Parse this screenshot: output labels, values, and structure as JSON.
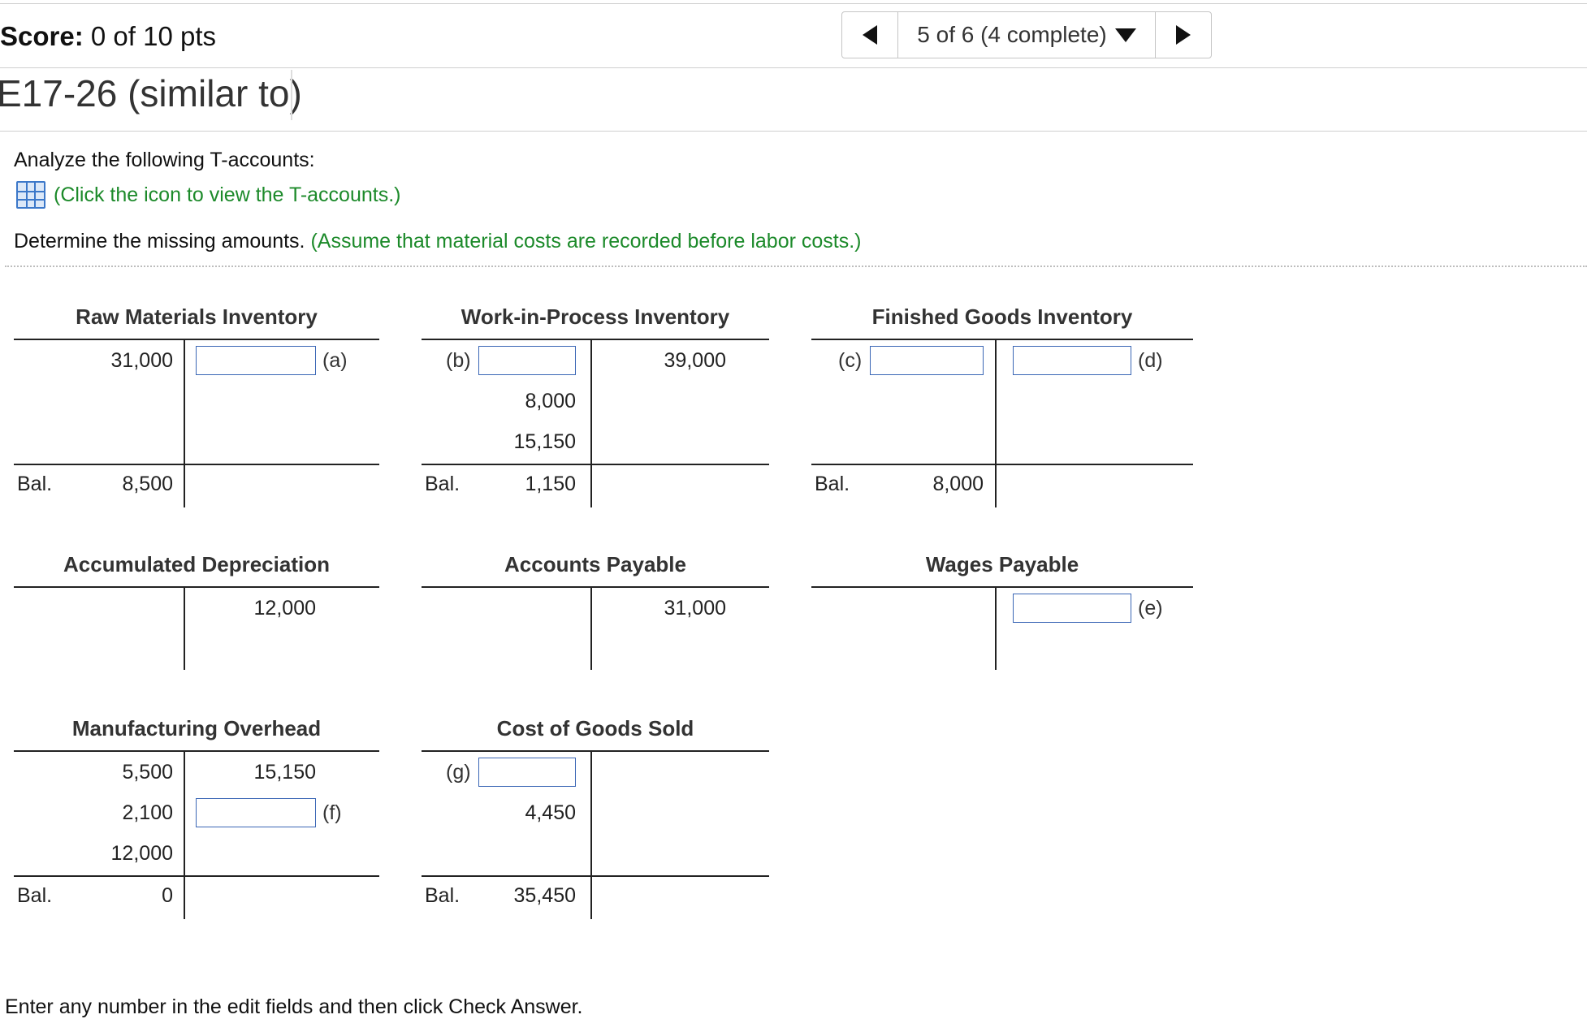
{
  "header": {
    "score_label": "Score:",
    "score_value": "0 of 10 pts",
    "nav_position": "5 of 6 (4 complete)",
    "question_title": "E17-26 (similar to)"
  },
  "instructions": {
    "line1": "Analyze the following T-accounts:",
    "icon_link": "(Click the icon to view the T-accounts.)",
    "line2_prefix": "Determine the missing amounts.",
    "line2_hint": "(Assume that material costs are recorded before labor costs.)"
  },
  "accounts": {
    "raw_materials": {
      "title": "Raw Materials Inventory",
      "debit1": "31,000",
      "credit1_label": "(a)",
      "bal_label": "Bal.",
      "bal_value": "8,500"
    },
    "wip": {
      "title": "Work-in-Process Inventory",
      "debit1_label": "(b)",
      "debit2": "8,000",
      "debit3": "15,150",
      "credit1": "39,000",
      "bal_label": "Bal.",
      "bal_value": "1,150"
    },
    "finished_goods": {
      "title": "Finished Goods Inventory",
      "debit1_label": "(c)",
      "credit1_label": "(d)",
      "bal_label": "Bal.",
      "bal_value": "8,000"
    },
    "accum_dep": {
      "title": "Accumulated Depreciation",
      "credit1": "12,000"
    },
    "accounts_payable": {
      "title": "Accounts Payable",
      "credit1": "31,000"
    },
    "wages_payable": {
      "title": "Wages Payable",
      "credit1_label": "(e)"
    },
    "mfg_overhead": {
      "title": "Manufacturing Overhead",
      "debit1": "5,500",
      "debit2": "2,100",
      "debit3": "12,000",
      "credit1": "15,150",
      "credit2_label": "(f)",
      "bal_label": "Bal.",
      "bal_value": "0"
    },
    "cogs": {
      "title": "Cost of Goods Sold",
      "debit1_label": "(g)",
      "debit2": "4,450",
      "bal_label": "Bal.",
      "bal_value": "35,450"
    }
  },
  "footer": {
    "text": "Enter any number in the edit fields and then click Check Answer."
  }
}
